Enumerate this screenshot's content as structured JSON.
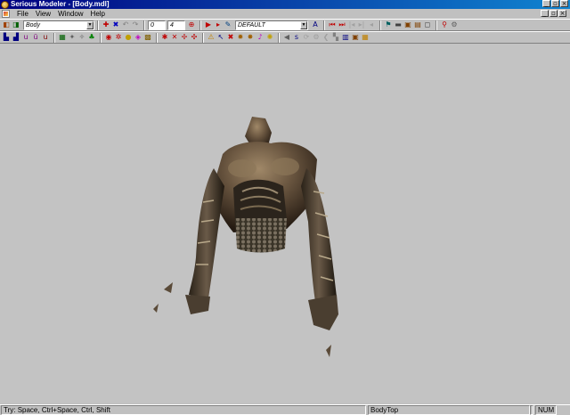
{
  "window": {
    "title": "Serious Modeler - [Body.mdl]"
  },
  "menu": {
    "items": [
      "File",
      "View",
      "Window",
      "Help"
    ]
  },
  "toolbar": {
    "mip_model_value": "Body",
    "frame_start": "0",
    "frame_end": "4",
    "animation_value": "DEFAULT"
  },
  "status": {
    "hint": "Try: Space, Ctrl+Space, Ctrl, Shift",
    "surface": "BodyTop",
    "num": "NUM"
  }
}
